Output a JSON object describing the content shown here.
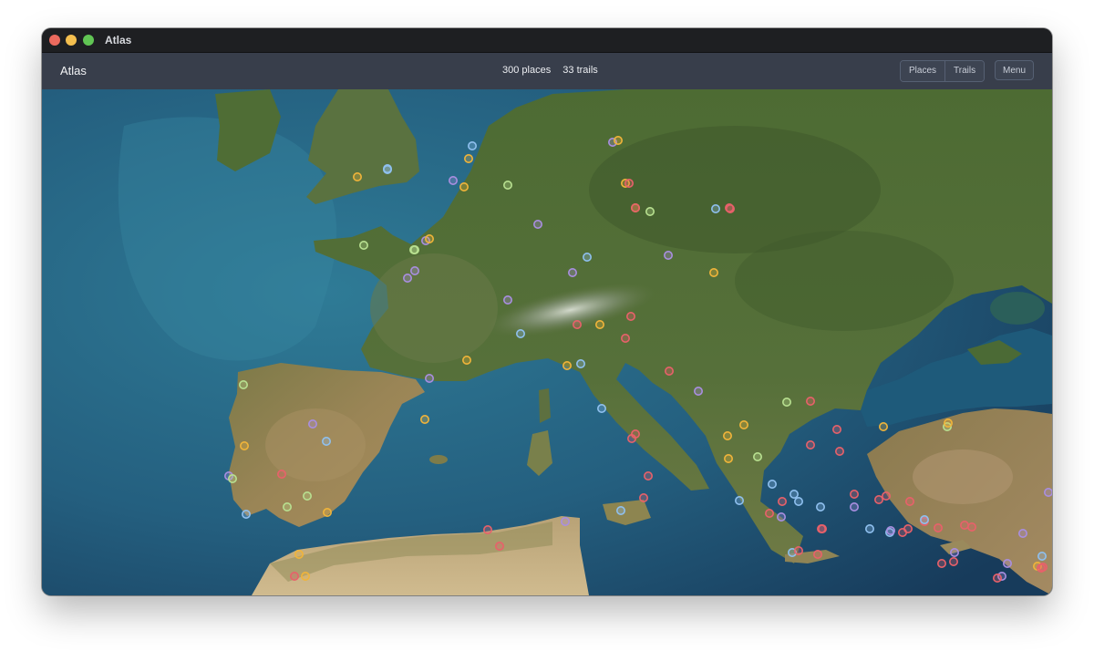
{
  "window": {
    "title": "Atlas",
    "traffic_lights": {
      "close": "#ec6a5e",
      "minimize": "#f4bf4f",
      "maximize": "#61c554"
    }
  },
  "toolbar": {
    "app_name": "Atlas",
    "places_count": "300 places",
    "trails_count": "33 trails",
    "places_tab": "Places",
    "trails_tab": "Trails",
    "menu": "Menu"
  },
  "map": {
    "style": "satellite",
    "region": "Europe and the Mediterranean",
    "marker_colors": {
      "red": "#e8616a",
      "yellow": "#f0b43a",
      "purple": "#a98ee0",
      "blue": "#8fc0ef",
      "green": "#b8e090"
    }
  }
}
